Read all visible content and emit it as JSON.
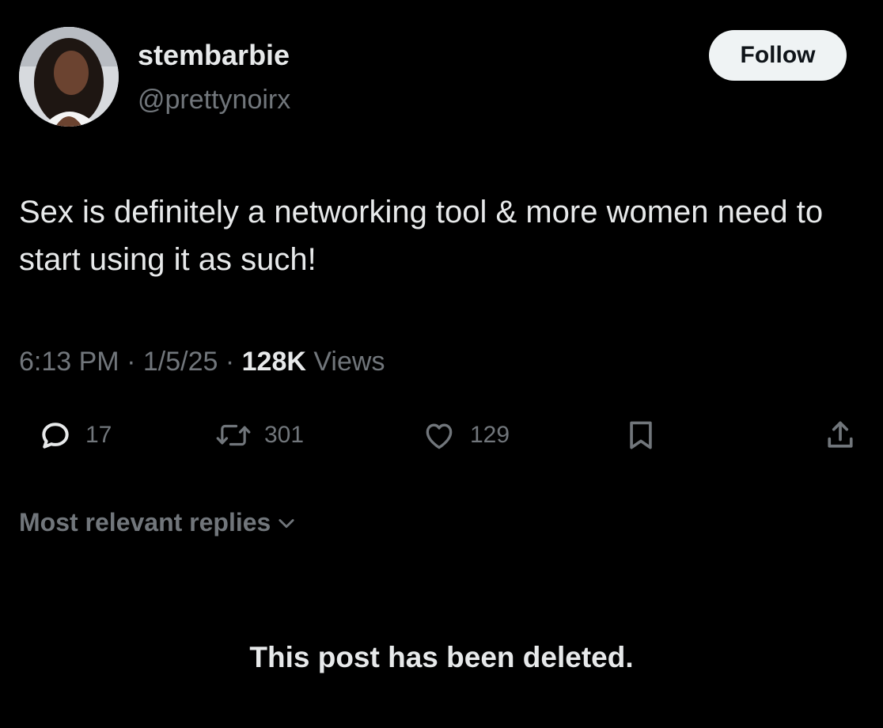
{
  "author": {
    "display_name": "stembarbie",
    "handle": "@prettynoirx"
  },
  "follow_label": "Follow",
  "tweet": {
    "text": "Sex is definitely a networking tool & more women need to start using it as such!"
  },
  "meta": {
    "time": "6:13 PM",
    "separator": "·",
    "date": "1/5/25",
    "views_count": "128K",
    "views_label": "Views"
  },
  "actions": {
    "reply_icon": "reply-icon",
    "reply_count": "17",
    "repost_icon": "repost-icon",
    "repost_count": "301",
    "like_icon": "heart-icon",
    "like_count": "129",
    "bookmark_icon": "bookmark-icon",
    "share_icon": "share-icon"
  },
  "replies": {
    "sort_label": "Most relevant replies",
    "deleted_notice": "This post has been deleted."
  },
  "colors": {
    "background": "#000000",
    "primary_text": "#e7e9ea",
    "secondary_text": "#71767b",
    "follow_button_bg": "#eff3f4"
  }
}
